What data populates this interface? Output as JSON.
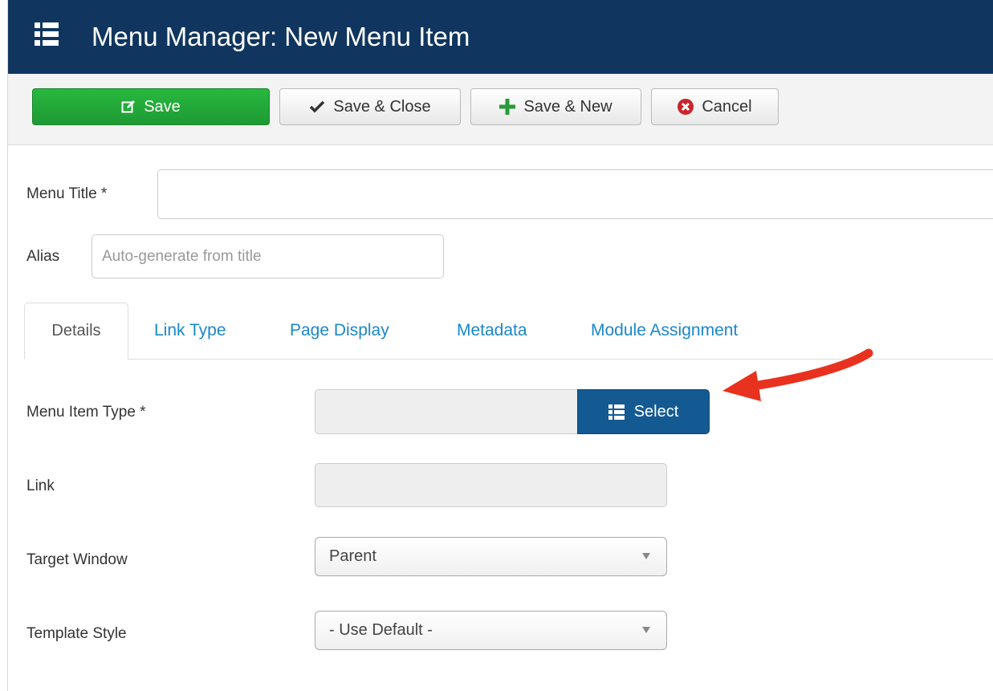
{
  "header": {
    "title": "Menu Manager: New Menu Item",
    "icon": "list-icon"
  },
  "toolbar": {
    "save": "Save",
    "save_close": "Save & Close",
    "save_new": "Save & New",
    "cancel": "Cancel"
  },
  "form": {
    "menu_title_label": "Menu Title *",
    "menu_title_value": "",
    "alias_label": "Alias",
    "alias_placeholder": "Auto-generate from title"
  },
  "tabs": [
    {
      "label": "Details",
      "active": true
    },
    {
      "label": "Link Type",
      "active": false
    },
    {
      "label": "Page Display",
      "active": false
    },
    {
      "label": "Metadata",
      "active": false
    },
    {
      "label": "Module Assignment",
      "active": false
    }
  ],
  "details": {
    "menu_item_type_label": "Menu Item Type *",
    "menu_item_type_value": "",
    "select_button": "Select",
    "link_label": "Link",
    "link_value": "",
    "target_window_label": "Target Window",
    "target_window_value": "Parent",
    "template_style_label": "Template Style",
    "template_style_value": "- Use Default -"
  },
  "colors": {
    "header_bg": "#10365f",
    "save_green": "#22a83a",
    "select_blue": "#145a92",
    "tab_link": "#1a87c9",
    "annotation_arrow": "#e8321f"
  }
}
